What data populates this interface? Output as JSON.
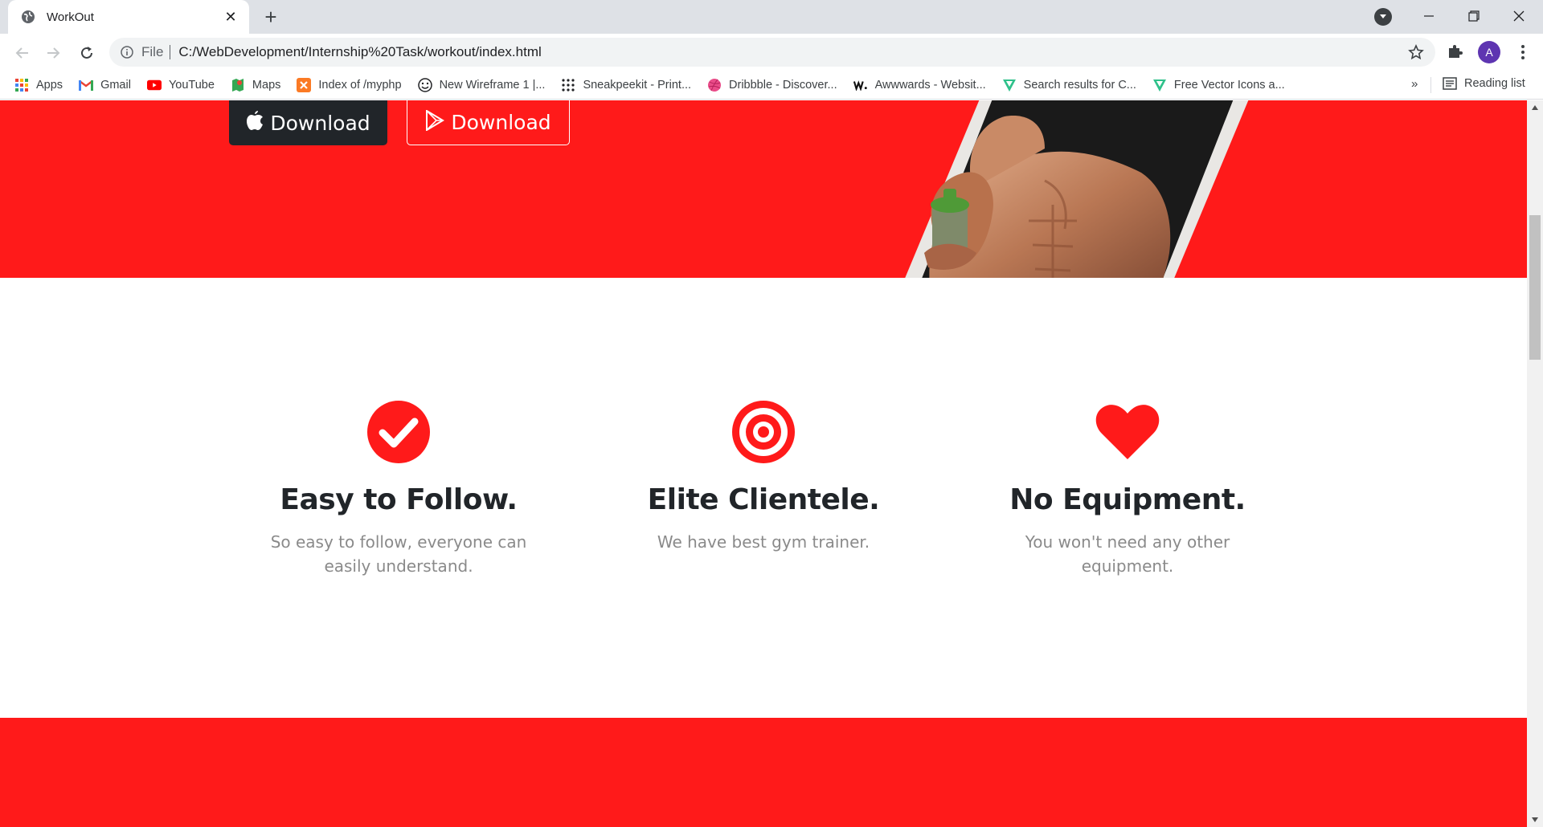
{
  "browser": {
    "tab_title": "WorkOut",
    "new_tab_symbol": "+",
    "close_symbol": "✕",
    "url_scheme": "File",
    "url": "C:/WebDevelopment/Internship%20Task/workout/index.html",
    "profile_initial": "A",
    "bookmarks": [
      {
        "label": "Apps",
        "icon": "apps-grid-icon"
      },
      {
        "label": "Gmail",
        "icon": "gmail-icon"
      },
      {
        "label": "YouTube",
        "icon": "youtube-icon"
      },
      {
        "label": "Maps",
        "icon": "maps-icon"
      },
      {
        "label": "Index of /myphp",
        "icon": "xampp-icon"
      },
      {
        "label": "New Wireframe 1 |...",
        "icon": "smiley-icon"
      },
      {
        "label": "Sneakpeekit - Print...",
        "icon": "dots-grid-icon"
      },
      {
        "label": "Dribbble - Discover...",
        "icon": "dribbble-icon"
      },
      {
        "label": "Awwwards - Websit...",
        "icon": "awwwards-icon"
      },
      {
        "label": "Search results for C...",
        "icon": "vector-icon"
      },
      {
        "label": "Free Vector Icons a...",
        "icon": "vector-icon"
      }
    ],
    "bookmarks_overflow": "»",
    "reading_list": "Reading list"
  },
  "hero": {
    "apple_button": "Download",
    "play_button": "Download"
  },
  "features": [
    {
      "icon": "check-circle-icon",
      "title": "Easy to Follow.",
      "text": "So easy to follow, everyone can easily understand."
    },
    {
      "icon": "target-icon",
      "title": "Elite Clientele.",
      "text": "We have best gym trainer."
    },
    {
      "icon": "heart-icon",
      "title": "No Equipment.",
      "text": "You won't need any other equipment."
    }
  ],
  "colors": {
    "brand_red": "#ff1a1a",
    "dark": "#212529",
    "muted_text": "#8a8a8a"
  }
}
